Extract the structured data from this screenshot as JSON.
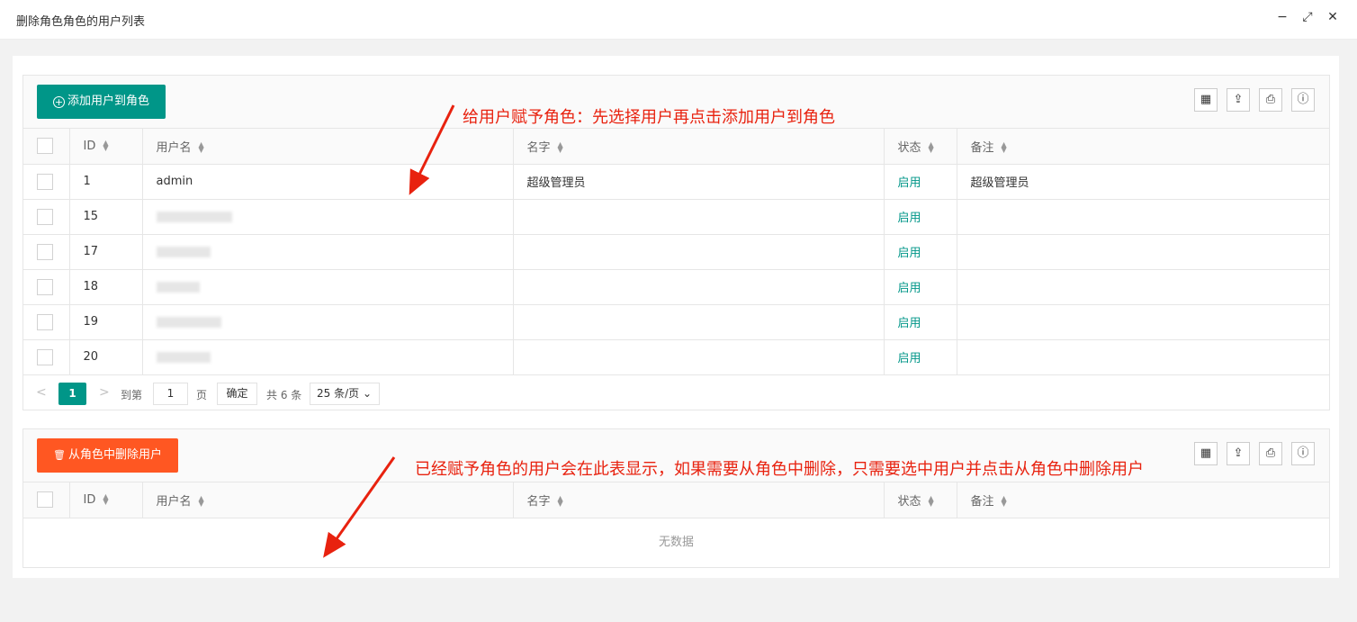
{
  "window": {
    "title": "删除角色角色的用户列表",
    "minimize_icon": "minus",
    "maximize_icon": "expand",
    "close_icon": "close"
  },
  "tools": {
    "columns": "▦",
    "export": "⇪",
    "print": "⎙",
    "info": "ⓘ"
  },
  "top_table": {
    "add_button": "添加用户到角色",
    "add_icon": "+",
    "columns": [
      "ID",
      "用户名",
      "名字",
      "状态",
      "备注"
    ],
    "rows": [
      {
        "id": "1",
        "username": "admin",
        "name": "超级管理员",
        "status": "启用",
        "remark": "超级管理员"
      },
      {
        "id": "15",
        "username": "",
        "name": "",
        "status": "启用",
        "remark": ""
      },
      {
        "id": "17",
        "username": "",
        "name": "",
        "status": "启用",
        "remark": ""
      },
      {
        "id": "18",
        "username": "",
        "name": "",
        "status": "启用",
        "remark": ""
      },
      {
        "id": "19",
        "username": "",
        "name": "",
        "status": "启用",
        "remark": ""
      },
      {
        "id": "20",
        "username": "",
        "name": "",
        "status": "启用",
        "remark": ""
      }
    ],
    "pager": {
      "prev": "<",
      "current": "1",
      "next": ">",
      "goto_label": "到第",
      "goto_value": "1",
      "page_unit": "页",
      "confirm": "确定",
      "total": "共 6 条",
      "page_size": "25 条/页"
    }
  },
  "bottom_table": {
    "delete_button": "从角色中删除用户",
    "delete_icon": "trash",
    "columns": [
      "ID",
      "用户名",
      "名字",
      "状态",
      "备注"
    ],
    "empty_text": "无数据"
  },
  "annotations": {
    "top": "给用户赋予角色：先选择用户再点击添加用户到角色",
    "bottom": "已经赋予角色的用户会在此表显示，如果需要从角色中删除，只需要选中用户并点击从角色中删除用户",
    "color": "#e8220f"
  },
  "colors": {
    "primary": "#009688",
    "danger": "#ff5722"
  }
}
